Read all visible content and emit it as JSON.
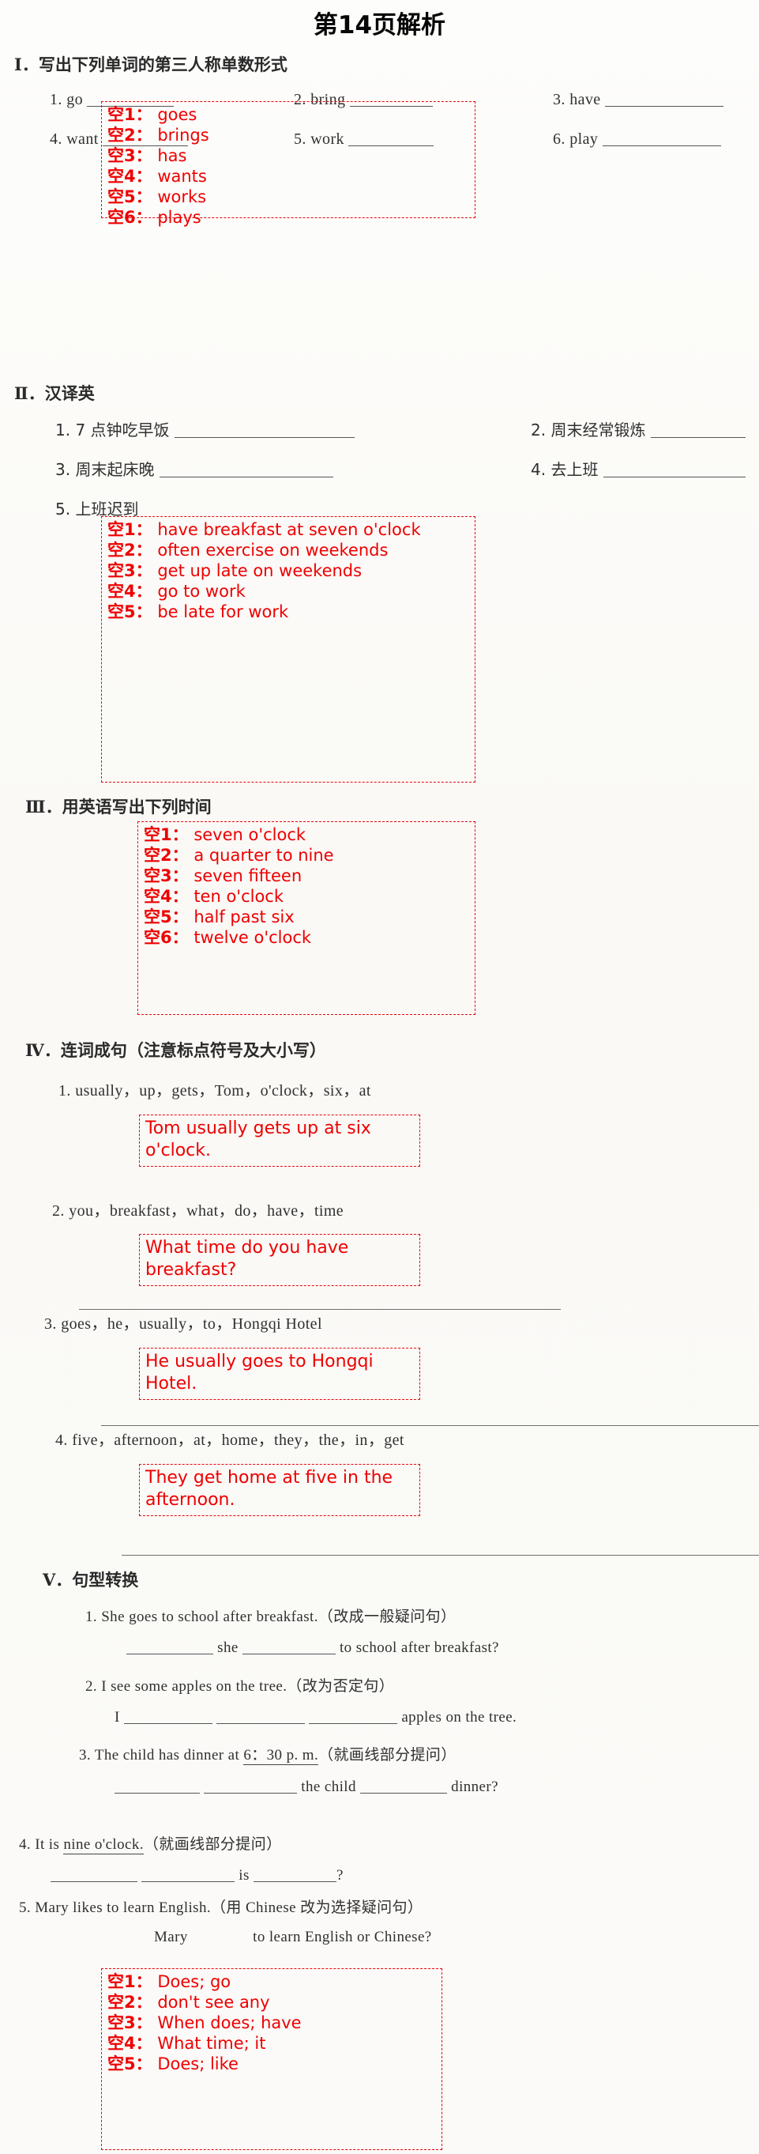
{
  "title": "第14页解析",
  "sections": [
    {
      "id": "I",
      "numeral": "Ⅰ",
      "heading": "．写出下列单词的第三人称单数形式",
      "questions": [
        {
          "num": "1.",
          "text": "go"
        },
        {
          "num": "2.",
          "text": "bring"
        },
        {
          "num": "3.",
          "text": "have"
        },
        {
          "num": "4.",
          "text": "want"
        },
        {
          "num": "5.",
          "text": "work"
        },
        {
          "num": "6.",
          "text": "play"
        }
      ],
      "answers": [
        {
          "key": "空1",
          "sep": "：",
          "value": "goes"
        },
        {
          "key": "空2",
          "sep": "：",
          "value": "brings"
        },
        {
          "key": "空3",
          "sep": "：",
          "value": "has"
        },
        {
          "key": "空4",
          "sep": "：",
          "value": "wants"
        },
        {
          "key": "空5",
          "sep": "：",
          "value": "works"
        },
        {
          "key": "空6",
          "sep": "：",
          "value": "plays"
        }
      ]
    },
    {
      "id": "II",
      "numeral": "Ⅱ",
      "heading": "．汉译英",
      "questions": [
        {
          "num": "1.",
          "text": "7 点钟吃早饭"
        },
        {
          "num": "2.",
          "text": "周末经常锻炼"
        },
        {
          "num": "3.",
          "text": "周末起床晚"
        },
        {
          "num": "4.",
          "text": "去上班"
        },
        {
          "num": "5.",
          "text": "上班迟到"
        }
      ],
      "answers": [
        {
          "key": "空1",
          "sep": "：",
          "value": "have breakfast at seven o'clock"
        },
        {
          "key": "空2",
          "sep": "：",
          "value": "often exercise on weekends"
        },
        {
          "key": "空3",
          "sep": "：",
          "value": "get up late on weekends"
        },
        {
          "key": "空4",
          "sep": "：",
          "value": "go to work"
        },
        {
          "key": "空5",
          "sep": "：",
          "value": "be late for work"
        }
      ]
    },
    {
      "id": "III",
      "numeral": "Ⅲ",
      "heading": "．用英语写出下列时间",
      "answers": [
        {
          "key": "空1",
          "sep": "：",
          "value": "seven o'clock"
        },
        {
          "key": "空2",
          "sep": "：",
          "value": "a quarter to nine"
        },
        {
          "key": "空3",
          "sep": "：",
          "value": "seven fifteen"
        },
        {
          "key": "空4",
          "sep": "：",
          "value": "ten o'clock"
        },
        {
          "key": "空5",
          "sep": "：",
          "value": "half past six"
        },
        {
          "key": "空6",
          "sep": "：",
          "value": "twelve o'clock"
        }
      ]
    },
    {
      "id": "IV",
      "numeral": "Ⅳ",
      "heading": "．连词成句（注意标点符号及大小写）",
      "items": [
        {
          "num": "1.",
          "prompt": "usually，up，gets，Tom，o'clock，six，at",
          "answer": "Tom usually gets up at six o'clock."
        },
        {
          "num": "2.",
          "prompt": "you，breakfast，what，do，have，time",
          "answer": "What time do you have breakfast?"
        },
        {
          "num": "3.",
          "prompt": "goes，he，usually，to，Hongqi Hotel",
          "answer": "He usually goes to Hongqi Hotel."
        },
        {
          "num": "4.",
          "prompt": "five，afternoon，at，home，they，the，in，get",
          "answer": "They get home at five in the afternoon."
        }
      ]
    },
    {
      "id": "V",
      "numeral": "Ⅴ",
      "heading": "．句型转换",
      "items": [
        {
          "num": "1.",
          "prompt": "She goes to school after breakfast.（改成一般疑问句）",
          "line_parts": [
            "",
            " she ",
            " to school after breakfast?"
          ]
        },
        {
          "num": "2.",
          "prompt": "I see some apples on the tree.（改为否定句）",
          "line_parts": [
            "I ",
            " ",
            " ",
            " apples on the tree."
          ]
        },
        {
          "num": "3.",
          "prompt_pre": "The child has dinner at ",
          "prompt_underlined": "6：30 p. m.",
          "prompt_post": "（就画线部分提问）",
          "line_parts": [
            "",
            " ",
            " the child ",
            " dinner?"
          ]
        },
        {
          "num": "4.",
          "prompt_pre": "It is ",
          "prompt_underlined": "nine o'clock.",
          "prompt_post": "（就画线部分提问）",
          "line_parts": [
            "",
            " ",
            " is ",
            "?"
          ]
        },
        {
          "num": "5.",
          "prompt": "Mary likes to learn English.（用 Chinese 改为选择疑问句）",
          "line_text": "Mary                to learn English or Chinese?"
        }
      ],
      "answers": [
        {
          "key": "空1",
          "sep": "：",
          "value": "Does; go"
        },
        {
          "key": "空2",
          "sep": "：",
          "value": "don't see any"
        },
        {
          "key": "空3",
          "sep": "：",
          "value": "When does; have"
        },
        {
          "key": "空4",
          "sep": "：",
          "value": "What time; it"
        },
        {
          "key": "空5",
          "sep": "：",
          "value": "Does; like"
        }
      ]
    }
  ],
  "colors": {
    "answer_red": "#ee0000",
    "box_border": "#e8070b",
    "text": "#1d1d1d"
  }
}
